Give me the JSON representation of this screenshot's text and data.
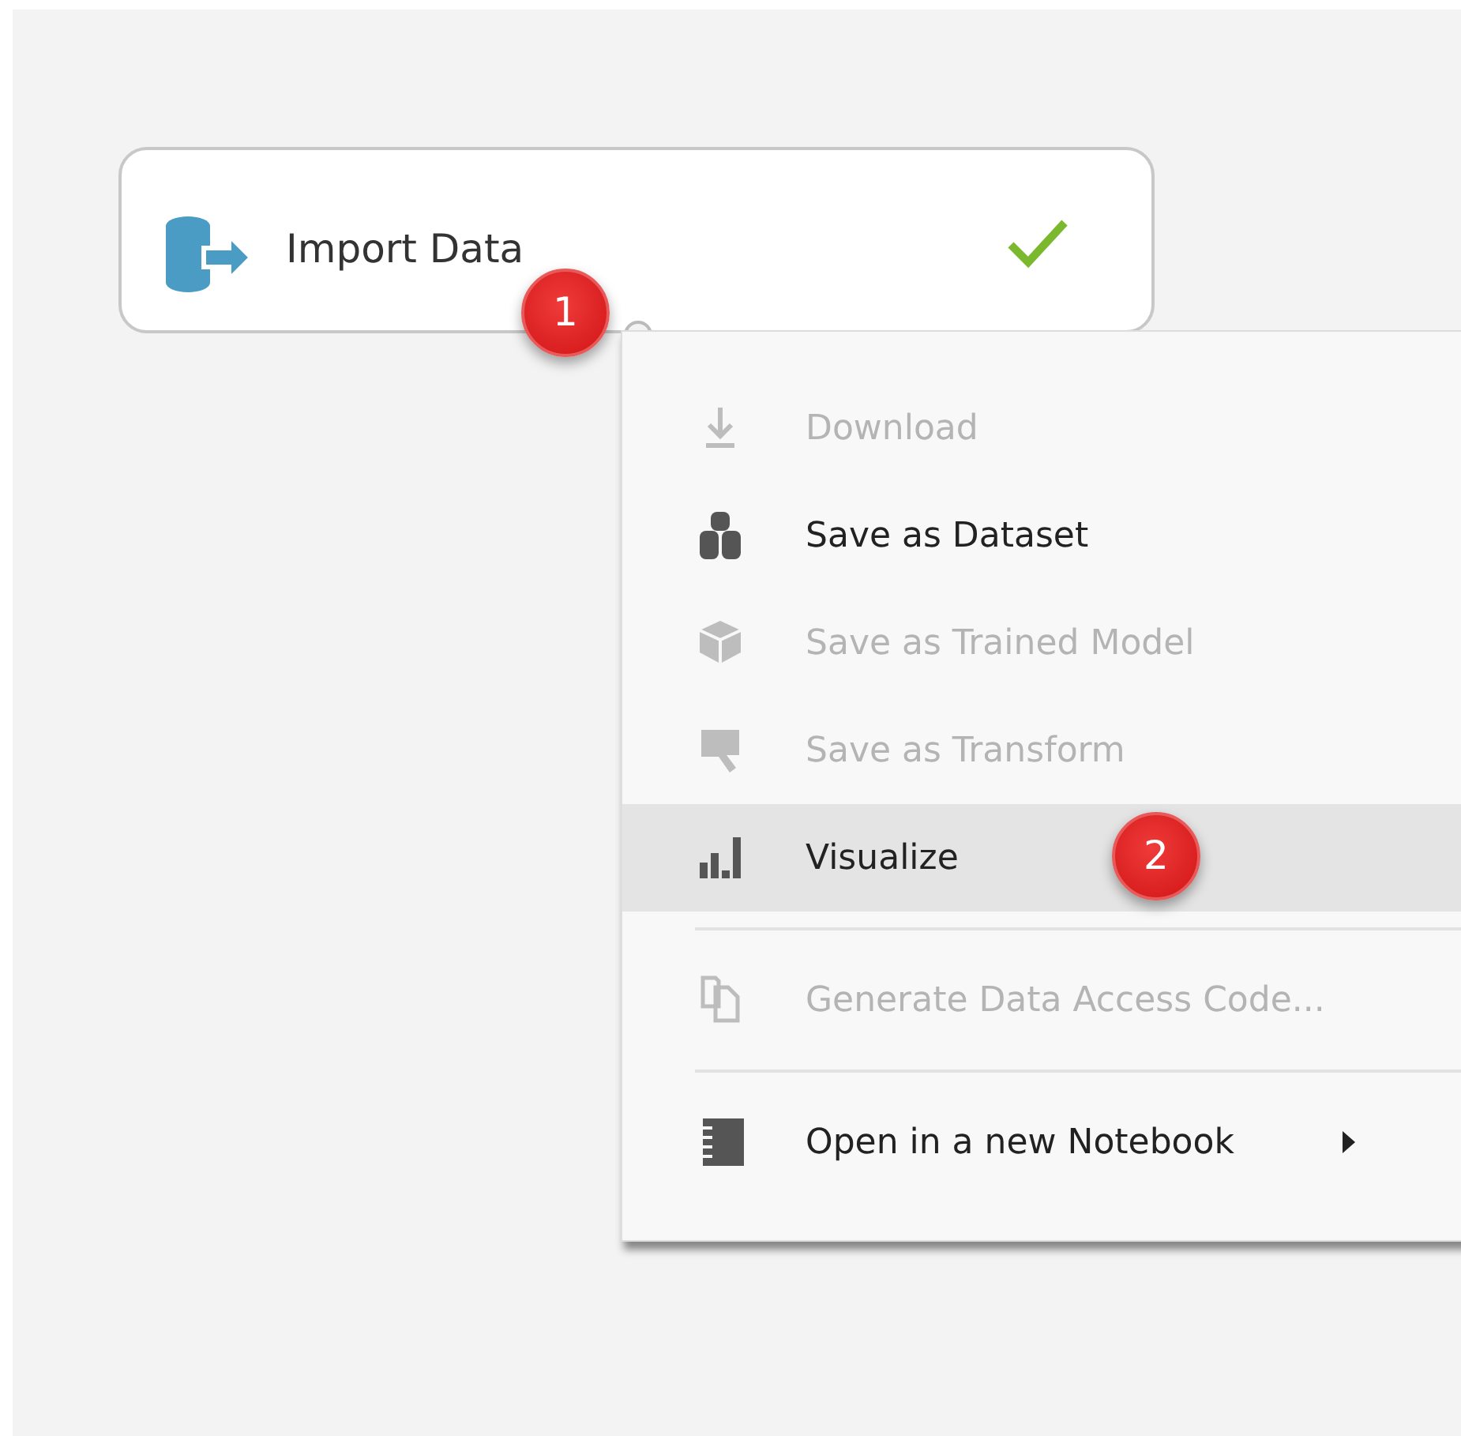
{
  "module": {
    "title": "Import Data",
    "completed": true
  },
  "context_menu": {
    "items": [
      {
        "kind": "item",
        "label": "Download",
        "disabled": true,
        "selected": false
      },
      {
        "kind": "item",
        "label": "Save as Dataset",
        "disabled": false,
        "selected": false
      },
      {
        "kind": "item",
        "label": "Save as Trained Model",
        "disabled": true,
        "selected": false
      },
      {
        "kind": "item",
        "label": "Save as Transform",
        "disabled": true,
        "selected": false
      },
      {
        "kind": "item",
        "label": "Visualize",
        "disabled": false,
        "selected": true
      },
      {
        "kind": "divider"
      },
      {
        "kind": "item",
        "label": "Generate Data Access Code...",
        "disabled": true,
        "selected": false
      },
      {
        "kind": "divider"
      },
      {
        "kind": "submenu",
        "label": "Open in a new Notebook",
        "disabled": false,
        "selected": false
      }
    ]
  },
  "callouts": [
    {
      "label": "1"
    },
    {
      "label": "2"
    }
  ]
}
